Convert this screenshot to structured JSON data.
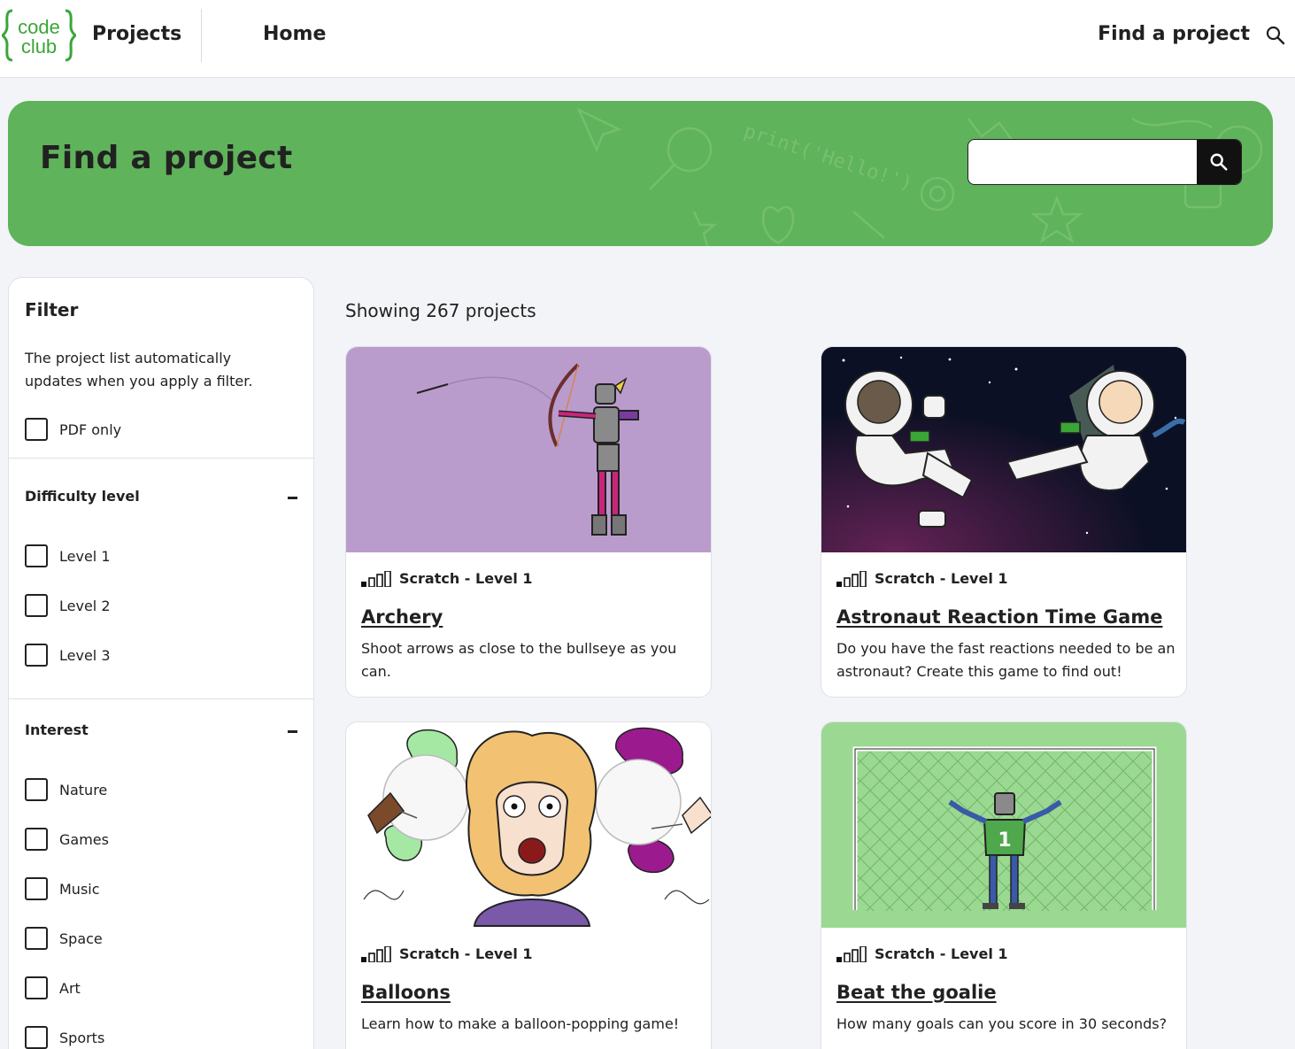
{
  "nav": {
    "logo_top": "code",
    "logo_bottom": "club",
    "brand": "Projects",
    "home": "Home",
    "find": "Find a project"
  },
  "hero": {
    "title": "Find a project",
    "search_placeholder": "",
    "deco_code": "print('Hello!')"
  },
  "filter": {
    "title": "Filter",
    "description": "The project list automatically updates when you apply a filter.",
    "pdf_only": "PDF only",
    "difficulty": {
      "title": "Difficulty level",
      "options": [
        "Level 1",
        "Level 2",
        "Level 3"
      ]
    },
    "interest": {
      "title": "Interest",
      "options": [
        "Nature",
        "Games",
        "Music",
        "Space",
        "Art",
        "Sports"
      ]
    }
  },
  "results": {
    "count_text": "Showing 267 projects",
    "cards": [
      {
        "meta": "Scratch - Level 1",
        "title": "Archery",
        "description": "Shoot arrows as close to the bullseye as you can."
      },
      {
        "meta": "Scratch - Level 1",
        "title": "Astronaut Reaction Time Game",
        "description": "Do you have the fast reactions needed to be an astronaut? Create this game to find out!"
      },
      {
        "meta": "Scratch - Level 1",
        "title": "Balloons",
        "description": "Learn how to make a balloon-popping game!"
      },
      {
        "meta": "Scratch - Level 1",
        "title": "Beat the goalie",
        "description": "How many goals can you score in 30 seconds?"
      }
    ]
  },
  "colors": {
    "hero_green": "#5fb35a",
    "logo_green": "#3aa637",
    "archery_bg": "#b99ccc",
    "space_bg": "#0b1024",
    "goalie_bg": "#9bd892"
  }
}
